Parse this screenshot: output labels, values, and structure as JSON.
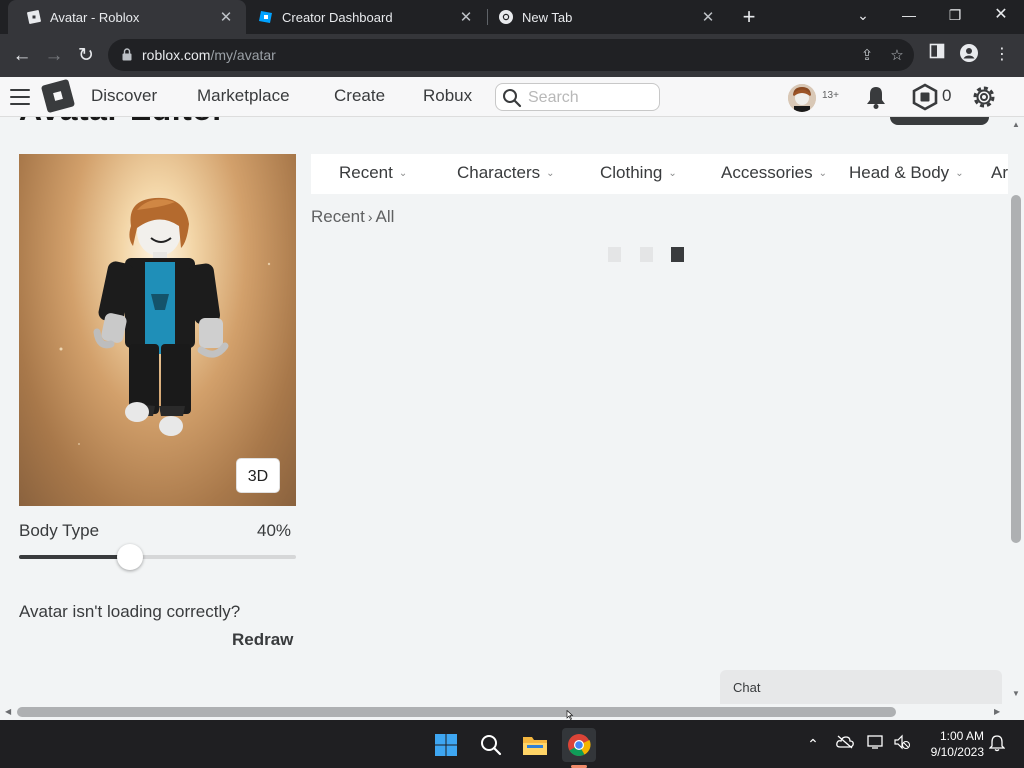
{
  "browser": {
    "tabs": [
      {
        "title": "Avatar - Roblox",
        "active": true,
        "icon": "roblox-icon"
      },
      {
        "title": "Creator Dashboard",
        "active": false,
        "icon": "roblox-studio-icon"
      },
      {
        "title": "New Tab",
        "active": false,
        "icon": "chrome-icon"
      }
    ],
    "url_host": "roblox.com",
    "url_path": "/my/avatar"
  },
  "roblox_nav": {
    "links": [
      "Discover",
      "Marketplace",
      "Create",
      "Robux"
    ],
    "search_placeholder": "Search",
    "age_badge": "13+",
    "robux_count": "0"
  },
  "page": {
    "title": "Avatar Editor",
    "button_3d": "3D",
    "body_type_label": "Body Type",
    "body_type_value": "40%",
    "body_type_fraction": 0.4,
    "not_loading_text": "Avatar isn't loading correctly?",
    "redraw_label": "Redraw",
    "categories": [
      "Recent",
      "Characters",
      "Clothing",
      "Accessories",
      "Head & Body",
      "Ar"
    ],
    "breadcrumb": {
      "root": "Recent",
      "current": "All"
    },
    "chat_label": "Chat"
  },
  "taskbar": {
    "time": "1:00 AM",
    "date": "9/10/2023"
  },
  "colors": {
    "chrome_dark": "#202124",
    "chrome_tab": "#35363a",
    "roblox_text": "#393b3d",
    "page_bg": "#f2f4f5",
    "taskbar": "#1f1f22"
  }
}
